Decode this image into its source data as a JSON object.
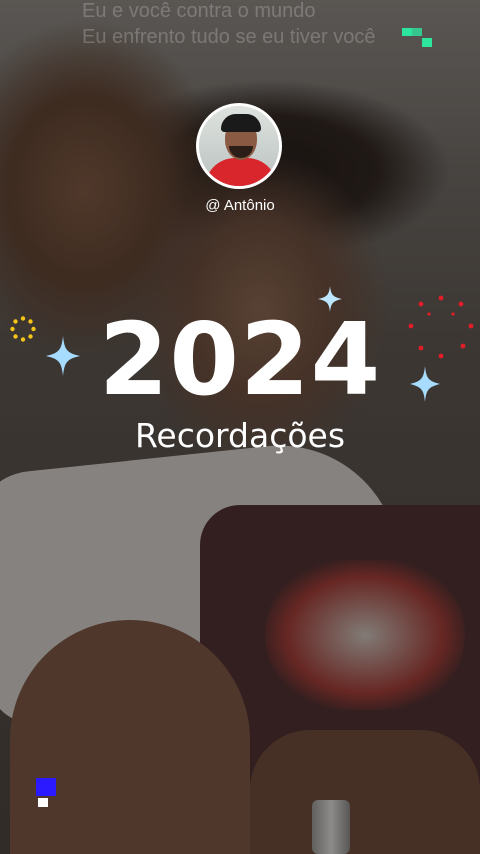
{
  "lyrics": {
    "line1": "Eu e você contra o mundo",
    "line2": "Eu enfrento tudo se eu tiver você"
  },
  "profile": {
    "username": "@ Antônio"
  },
  "title": {
    "year": "2024",
    "subtitle": "Recordações"
  },
  "decorations": {
    "sparkle_icon": "sparkle-icon",
    "firework_icon": "firework-icon",
    "burst_icon": "sun-burst-icon",
    "sparkle_color": "#9fd6ff",
    "firework_color": "#e11d2a",
    "burst_color": "#f5c518",
    "pixel_green": "#2ee59d",
    "pixel_blue": "#2b1aff"
  }
}
